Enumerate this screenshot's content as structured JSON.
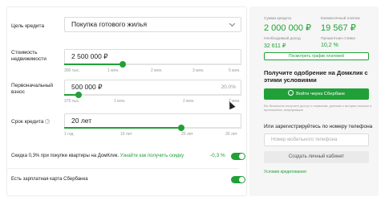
{
  "form": {
    "goal": {
      "label": "Цель кредита",
      "value": "Покупка готового жилья"
    },
    "property": {
      "label": "Стоимость недвижимости",
      "value": "2 500 000 ₽",
      "ticks": [
        "300 тыс.",
        "1 млн.",
        "2 млн.",
        "3 млн.",
        "5 млн."
      ]
    },
    "downpayment": {
      "label": "Первоначальный взнос",
      "value": "500 000 ₽",
      "percent": "20.0%",
      "ticks": [
        "375 тыс.",
        "1 млн.",
        "2 млн.",
        "2 млн."
      ]
    },
    "term": {
      "label": "Срок кредита",
      "value": "20 лет",
      "ticks": [
        "1 год",
        "10 лет",
        "20 лет",
        "30 лет"
      ]
    },
    "discount": {
      "text": "Скидка 0,3% при покупке квартиры на ДомКлик.",
      "link": "Узнайте как получить скидку",
      "value": "-0,3 %"
    },
    "salary": {
      "text": "Есть зарплатная карта Сбербанка"
    }
  },
  "sliders": {
    "property_fill": 0.33,
    "downpayment_fill": 0.08,
    "term_fill": 0.66
  },
  "summary": {
    "loan_label": "Сумма кредита",
    "loan_value": "2 000 000 ₽",
    "payment_label": "Ежемесячный платеж",
    "payment_value": "19 567 ₽",
    "income_label": "Необходимый доход",
    "income_value": "32 611 ₽",
    "rate_label": "Процентная ставка",
    "rate_value": "10,2 %",
    "schedule_button": "Посмотреть график платежей"
  },
  "approval": {
    "heading": "Получите одобрение на Домклик с этими условиями",
    "sber_button": "Войти через Сбербанк",
    "fine_print": "Вы безопасно получите доступ к сервисам, данным и истории покупок в приложении, информации",
    "phone_label": "Или зарегистрируйтесь по номеру телефона",
    "phone_placeholder": "Номер мобильного телефона",
    "create_button": "Создать личный кабинет",
    "terms_link": "Условия кредитования"
  },
  "colors": {
    "accent": "#21a038"
  }
}
